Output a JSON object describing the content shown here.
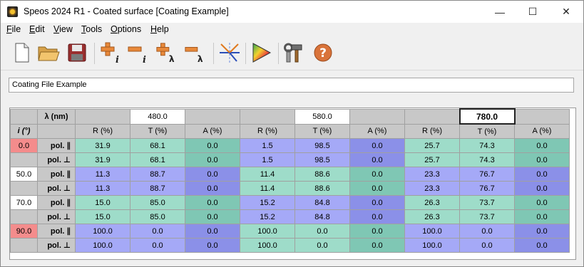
{
  "window": {
    "title": "Speos 2024 R1 - Coated surface [Coating Example]",
    "controls": [
      "—",
      "☐",
      "✕"
    ]
  },
  "menu": [
    "File",
    "Edit",
    "View",
    "Tools",
    "Options",
    "Help"
  ],
  "menu_accel": [
    "F",
    "E",
    "V",
    "T",
    "O",
    "H"
  ],
  "toolbar": {
    "add_i_sub": "i",
    "remove_i_sub": "i",
    "add_lambda_sub": "λ",
    "remove_lambda_sub": "λ"
  },
  "coating_name": "Coating File Example",
  "table": {
    "lambda_label": "λ (nm)",
    "incidence_label": "i (°)",
    "wavelengths": [
      "480.0",
      "580.0",
      "780.0"
    ],
    "col_headers": [
      "R (%)",
      "T (%)",
      "A (%)"
    ],
    "pol_labels": [
      "pol. ∥",
      "pol. ⊥"
    ],
    "angles": [
      "0.0",
      "50.0",
      "70.0",
      "90.0"
    ],
    "rows": [
      [
        "31.9",
        "68.1",
        "0.0",
        "1.5",
        "98.5",
        "0.0",
        "25.7",
        "74.3",
        "0.0"
      ],
      [
        "31.9",
        "68.1",
        "0.0",
        "1.5",
        "98.5",
        "0.0",
        "25.7",
        "74.3",
        "0.0"
      ],
      [
        "11.3",
        "88.7",
        "0.0",
        "11.4",
        "88.6",
        "0.0",
        "23.3",
        "76.7",
        "0.0"
      ],
      [
        "11.3",
        "88.7",
        "0.0",
        "11.4",
        "88.6",
        "0.0",
        "23.3",
        "76.7",
        "0.0"
      ],
      [
        "15.0",
        "85.0",
        "0.0",
        "15.2",
        "84.8",
        "0.0",
        "26.3",
        "73.7",
        "0.0"
      ],
      [
        "15.0",
        "85.0",
        "0.0",
        "15.2",
        "84.8",
        "0.0",
        "26.3",
        "73.7",
        "0.0"
      ],
      [
        "100.0",
        "0.0",
        "0.0",
        "100.0",
        "0.0",
        "0.0",
        "100.0",
        "0.0",
        "0.0"
      ],
      [
        "100.0",
        "0.0",
        "0.0",
        "100.0",
        "0.0",
        "0.0",
        "100.0",
        "0.0",
        "0.0"
      ]
    ]
  },
  "colors": {
    "angle_highlight": "#f48c8c",
    "green_light": "#9edcc9",
    "green_dark": "#7fc7b4",
    "blue_light": "#a5a9f7",
    "blue_dark": "#8b90e8"
  }
}
